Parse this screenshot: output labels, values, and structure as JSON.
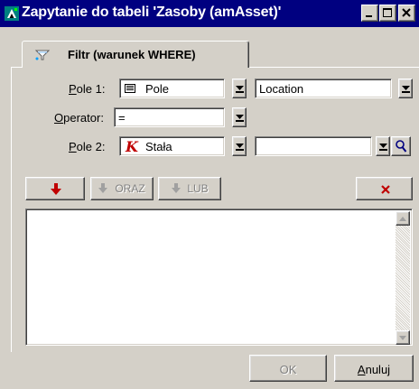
{
  "window": {
    "title": "Zapytanie do tabeli 'Zasoby (amAsset)'",
    "title_bg": "#000080",
    "icon": "app-icon"
  },
  "tab": {
    "label": "Filtr (warunek WHERE)",
    "icon": "filter-icon"
  },
  "form": {
    "field1": {
      "label": "Pole 1:",
      "type_value": "Pole",
      "type_icon": "field-icon",
      "value": "Location"
    },
    "operator": {
      "label": "Operator:",
      "value": "="
    },
    "field2": {
      "label": "Pole 2:",
      "type_value": "Stała",
      "type_icon": "constant-icon",
      "value": ""
    }
  },
  "toolbar": {
    "add_icon": "arrow-down-icon",
    "and_label": "ORAZ",
    "or_label": "LUB",
    "delete_icon": "delete-x-icon",
    "accent_red": "#c00000"
  },
  "footer": {
    "ok_label": "OK",
    "cancel_label": "Anuluj"
  }
}
